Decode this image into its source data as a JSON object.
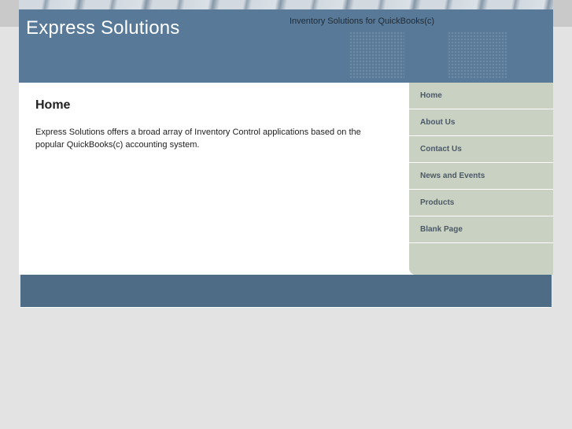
{
  "header": {
    "site_title": "Express Solutions",
    "tagline": "Inventory Solutions for QuickBooks(c)"
  },
  "main": {
    "heading": "Home",
    "intro": "Express Solutions offers a broad array of Inventory Control applications based on the popular QuickBooks(c) accounting system."
  },
  "nav": {
    "items": [
      {
        "label": "Home"
      },
      {
        "label": "About Us"
      },
      {
        "label": "Contact Us"
      },
      {
        "label": "News and Events"
      },
      {
        "label": "Products"
      },
      {
        "label": "Blank Page"
      }
    ]
  },
  "colors": {
    "header_bg": "#587a98",
    "sidebar_bg": "#c9d2c2",
    "footer_bg": "#4f6c87",
    "page_bg": "#e3e3e3"
  }
}
